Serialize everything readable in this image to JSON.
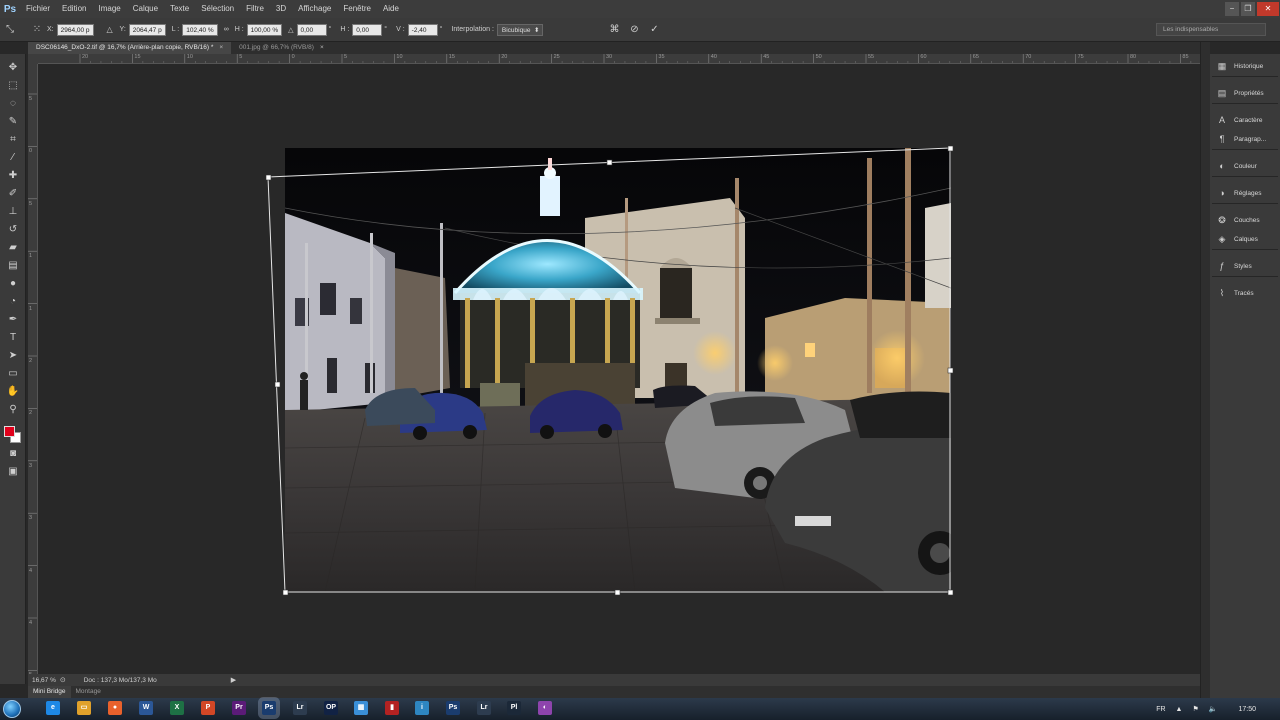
{
  "app": {
    "logo": "Ps"
  },
  "menu": [
    "Fichier",
    "Edition",
    "Image",
    "Calque",
    "Texte",
    "Sélection",
    "Filtre",
    "3D",
    "Affichage",
    "Fenêtre",
    "Aide"
  ],
  "window_controls": {
    "minimize": "−",
    "restore": "❐",
    "close": "✕"
  },
  "options": {
    "x_label": "X:",
    "x_value": "2964,00 p",
    "y_label": "Y:",
    "y_value": "2064,47 p",
    "w_label": "L :",
    "w_value": "102,40 %",
    "link_icon": "∞",
    "h_label": "H :",
    "h_value": "100,00 %",
    "angle_label": "△",
    "angle_value": "0,00",
    "deg": "°",
    "skew_h_label": "H :",
    "skew_h_value": "0,00",
    "skew_v_label": "V :",
    "skew_v_value": "-2,40",
    "interp_label": "Interpolation :",
    "interp_value": "Bicubique",
    "workspace": "Les indispensables"
  },
  "tabs": [
    {
      "label": "DSC06146_DxO-2.tif @ 16,7% (Arrière-plan copie, RVB/16) *",
      "close": "×"
    },
    {
      "label": "001.jpg @ 66,7% (RVB/8)",
      "close": "×"
    }
  ],
  "ruler_h_ticks": [
    "20",
    "15",
    "10",
    "5",
    "0",
    "5",
    "10",
    "15",
    "20",
    "25",
    "30",
    "35",
    "40",
    "45",
    "50",
    "55",
    "60",
    "65",
    "70",
    "75",
    "80",
    "85"
  ],
  "ruler_v_ticks": [
    "5",
    "0",
    "5",
    "1",
    "1",
    "2",
    "2",
    "3",
    "3",
    "4",
    "4",
    "5"
  ],
  "status": {
    "zoom": "16,67 %",
    "doc": "Doc : 137,3 Mo/137,3 Mo",
    "arrow": "▶"
  },
  "bridge_tabs": [
    "Mini Bridge",
    "Montage"
  ],
  "panels": [
    {
      "label": "Historique",
      "icon": "history-icon"
    },
    {
      "label": "Propriétés",
      "icon": "properties-icon"
    },
    {
      "label": "Caractère",
      "icon": "character-icon"
    },
    {
      "label": "Paragrap...",
      "icon": "paragraph-icon"
    },
    {
      "label": "Couleur",
      "icon": "color-icon"
    },
    {
      "label": "Réglages",
      "icon": "adjustments-icon"
    },
    {
      "label": "Couches",
      "icon": "channels-icon"
    },
    {
      "label": "Calques",
      "icon": "layers-icon"
    },
    {
      "label": "Styles",
      "icon": "styles-icon"
    },
    {
      "label": "Tracés",
      "icon": "paths-icon"
    }
  ],
  "colors": {
    "foreground": "#e0001b",
    "background": "#ffffff",
    "accent": "#9fd3ff"
  },
  "taskbar": {
    "apps": [
      {
        "label": "e",
        "color": "#1e88e5"
      },
      {
        "label": "▭",
        "color": "#e0a12b"
      },
      {
        "label": "●",
        "color": "#e8612c"
      },
      {
        "label": "W",
        "color": "#2b5797"
      },
      {
        "label": "X",
        "color": "#1e7145"
      },
      {
        "label": "P",
        "color": "#d24726"
      },
      {
        "label": "Pr",
        "color": "#5b1b78"
      },
      {
        "label": "Ps",
        "color": "#1a3c6e"
      },
      {
        "label": "Lr",
        "color": "#2d3c4f"
      },
      {
        "label": "OP",
        "color": "#112244"
      },
      {
        "label": "▦",
        "color": "#3a8fd8"
      },
      {
        "label": "▮",
        "color": "#b22222"
      },
      {
        "label": "i",
        "color": "#2e86c1"
      },
      {
        "label": "Ps",
        "color": "#1a3c6e"
      },
      {
        "label": "Lr",
        "color": "#2d3c4f"
      },
      {
        "label": "Pl",
        "color": "#1b2838"
      },
      {
        "label": "◐",
        "color": "#8e44ad"
      }
    ],
    "lang": "FR",
    "time": "17:50"
  }
}
